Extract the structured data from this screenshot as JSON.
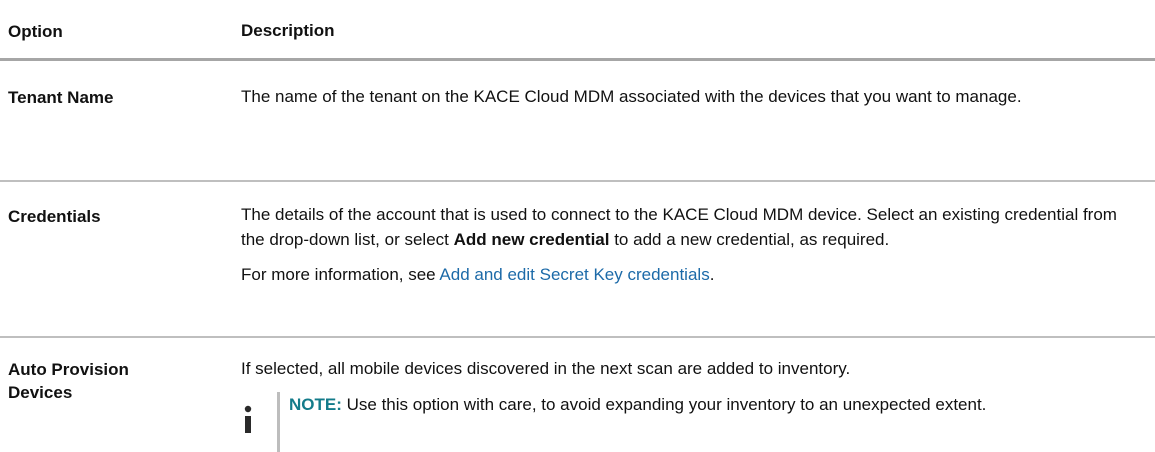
{
  "header": {
    "option": "Option",
    "description": "Description"
  },
  "rows": [
    {
      "option": "Tenant Name",
      "description": "The name of the tenant on the KACE Cloud MDM associated with the devices that you want to manage."
    },
    {
      "option": "Credentials",
      "description_part1": "The details of the account that is used to connect to the KACE Cloud MDM device. Select an existing credential from the drop-down list, or select ",
      "description_bold": "Add new credential",
      "description_part2": " to add a new credential, as required.",
      "more_info_prefix": "For more information, see ",
      "more_info_link": "Add and edit Secret Key credentials",
      "more_info_suffix": "."
    },
    {
      "option_line1": "Auto Provision",
      "option_line2": "Devices",
      "description": "If selected, all mobile devices discovered in the next scan are added to inventory.",
      "note_label": "NOTE:",
      "note_text": " Use this option with care, to avoid expanding your inventory to an unexpected extent."
    }
  ],
  "colors": {
    "link": "#1c6aa8",
    "note_label": "#137b8a",
    "rule": "#bfbfbf"
  },
  "icons": {
    "note": "info-icon"
  }
}
